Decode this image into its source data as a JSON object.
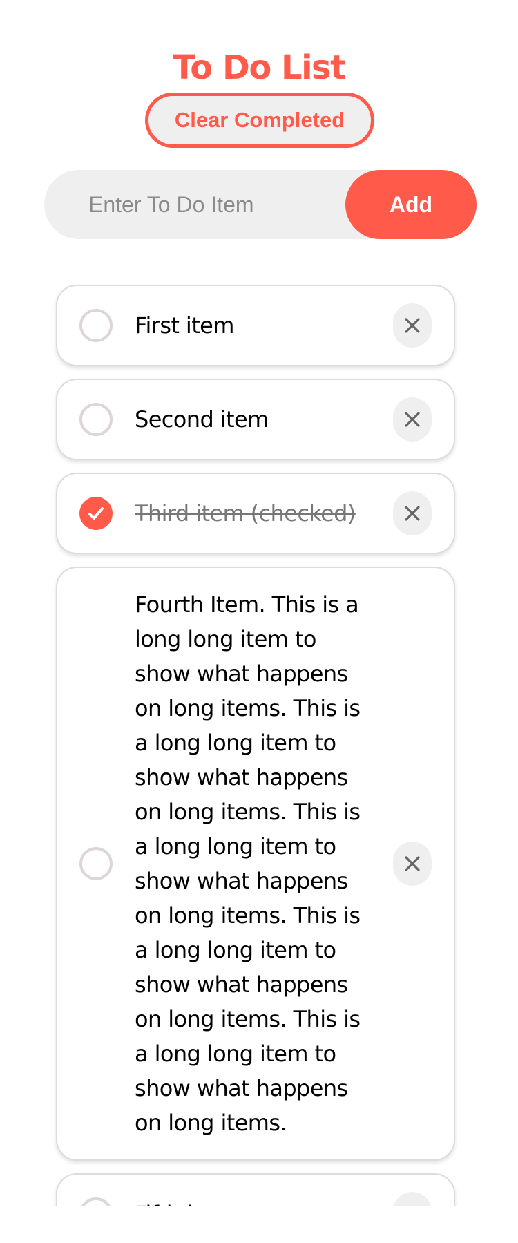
{
  "app": {
    "title": "To Do List",
    "clear_label": "Clear Completed",
    "input_placeholder": "Enter To Do Item",
    "add_label": "Add"
  },
  "items": [
    {
      "text": "First item",
      "checked": false
    },
    {
      "text": "Second item",
      "checked": false
    },
    {
      "text": "Third item (checked)",
      "checked": true
    },
    {
      "text": "Fourth Item. This is a long long item to show what happens on long items. This is a long long item to show what happens on long items. This is a long long item to show what happens on long items. This is a long long item to show what happens on long items. This is a long long item to show what happens on long items.",
      "checked": false
    },
    {
      "text": "Fifth item",
      "checked": false
    }
  ],
  "icons": {
    "checkbox": "circle-checkbox-icon",
    "checked": "checkmark-icon",
    "delete": "close-icon"
  },
  "colors": {
    "accent": "#ff5a4a",
    "surface": "#efefef",
    "border": "#dcdcdc"
  }
}
